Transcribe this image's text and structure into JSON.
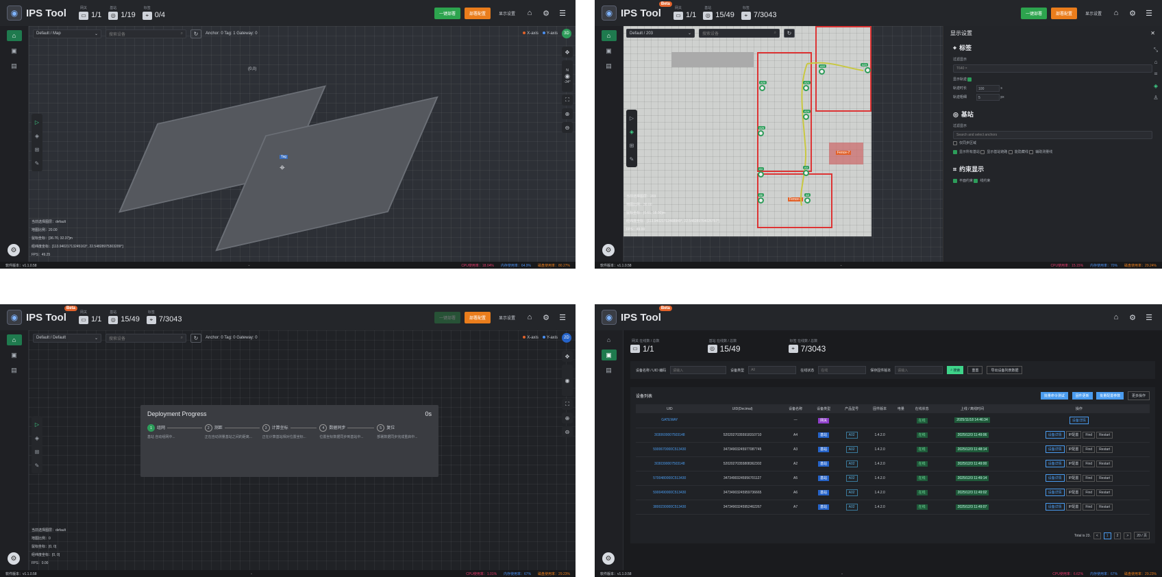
{
  "common": {
    "brand": "IPS Tool",
    "beta": "Beta",
    "btn_deploy": "一键部署",
    "btn_config": "部署配置",
    "btn_display": "显示设置",
    "version": "软件版本：v1.1.0.58",
    "axis_x": "X-axis",
    "axis_y": "Y-axis",
    "search_placeholder": "搜索设备",
    "stat_gateway": "网关",
    "stat_anchor": "基站",
    "stat_tag": "标签"
  },
  "p1": {
    "gateway": "1/1",
    "anchor": "1/19",
    "tag": "0/4",
    "map": "Default / Map",
    "counts": "Anchor: 0  Tag: 1  Gateway: 0",
    "avatar": "3D",
    "origin_label": "(0,0)",
    "tag_label": "Tag",
    "compass_top": "N",
    "compass_val": "30°",
    "compass_deg": "-34°",
    "info": [
      "当前选择图层：default",
      "地图比例：20.00",
      "鼠标坐标：[36.70, 32.37]m",
      "经纬度坐标：[113.94021713245163°, 22.54828975303209°]",
      "FPS：49.25"
    ],
    "cpu": "CPU使用率：18.04%",
    "ram": "内存使用率：64.9%",
    "disk": "磁盘使用率：80.27%"
  },
  "p2": {
    "gateway": "1/1",
    "anchor": "15/49",
    "tag": "7/3043",
    "map": "Default / 203",
    "settings_title": "显示设置",
    "sec_tag": "标签",
    "filter_label": "过滤显示",
    "filter_val": "T640 ×",
    "show_track": "显示轨迹",
    "track_time_label": "轨迹时长",
    "track_time_val": "100",
    "track_time_unit": "s",
    "track_width_label": "轨迹粗细",
    "track_width_val": "5",
    "track_width_unit": "px",
    "sec_anchor": "基站",
    "anchor_filter_placeholder": "Search and select anchors",
    "opt_sync": "仅同步区域",
    "opt_all": "显示所有基站",
    "opt_link": "显示基站链路",
    "opt_ghost": "能隐藏线",
    "opt_aux": "辅助测量线",
    "sec_constraint": "约束显示",
    "opt_plane": "平面约束",
    "opt_line": "线约束",
    "fence_label": "Fence-7",
    "fence_label2": "Fence-3",
    "info": [
      "当前选择图层：203",
      "地图比例：30.00",
      "鼠标坐标：[0.61, 18.90]m",
      "经纬度坐标：[113.94021712468849°, 22.548289764026757°]",
      "FPS：49.00"
    ],
    "cpu": "CPU使用率：15.15%",
    "ram": "内存使用率：70%",
    "disk": "磁盘使用率：29.24%",
    "anchor_labels": [
      "A20",
      "A21",
      "A22",
      "A23",
      "A24",
      "A25",
      "A4",
      "A3",
      "A6",
      "A5"
    ]
  },
  "p3": {
    "gateway": "1/1",
    "anchor": "15/49",
    "tag": "7/3043",
    "map": "Default / Default",
    "counts": "Anchor: 0  Tag: 0  Gateway: 0",
    "avatar": "2D",
    "modal_title": "Deployment Progress",
    "modal_time": "0s",
    "steps": [
      {
        "num": "1",
        "label": "组网",
        "desc": "基站 自动组网中..."
      },
      {
        "num": "2",
        "label": "测距",
        "desc": "正在自动测量基站之间的距离..."
      },
      {
        "num": "3",
        "label": "计算坐标",
        "desc": "正在计算基站相对位置坐标..."
      },
      {
        "num": "4",
        "label": "数据同步",
        "desc": "位置坐标数据同步到基站中..."
      },
      {
        "num": "5",
        "label": "复位",
        "desc": "部署数据同步完成重启中..."
      }
    ],
    "info": [
      "当前选择图层：default",
      "地图比例：0",
      "鼠标坐标：[0, 0]",
      "经纬度坐标：[0, 0]",
      "FPS：0.00"
    ],
    "cpu": "CPU使用率：1.01%",
    "ram": "内存使用率：67%",
    "disk": "磁盘使用率：29.23%"
  },
  "p4": {
    "gateway": "1/1",
    "anchor": "15/49",
    "tag": "7/3043",
    "lbl_gateway": "网关 在线数 / 总数",
    "lbl_anchor": "基站 在线数 / 总数",
    "lbl_tag": "标签 在线数 / 总数",
    "f_name": "设备名称 / UID 编码",
    "f_name_ph": "请输入",
    "f_type": "设备类型",
    "f_type_val": "All",
    "f_status": "在线状态",
    "f_status_val": "在线",
    "f_fw": "保存固件版本",
    "f_fw_ph": "请输入",
    "btn_search": "搜索",
    "btn_reset": "重置",
    "btn_export": "导出设备列表数据",
    "list_title": "设备列表",
    "btn_a": "批量命令测试",
    "btn_b": "固件更新",
    "btn_c": "批量配置参数",
    "btn_d": "更多操作",
    "cols": [
      "UID",
      "UID(Decimal)",
      "设备名称",
      "设备类型",
      "产品型号",
      "固件版本",
      "电量",
      "在线状态",
      "上线 / 离线时间",
      "操作"
    ],
    "rows": [
      {
        "uid": "GATEWAY",
        "dec": "",
        "name": "—",
        "type": "网关",
        "model": "",
        "fw": "",
        "batt": "",
        "status": "在线",
        "time": "2025/11/18 14:46:34",
        "ops": [
          "设备详情"
        ]
      },
      {
        "uid": "3030600007503148",
        "dec": "52020270355918310710",
        "name": "A4",
        "type": "基站",
        "model": "A02",
        "fw": "1.4.2.0",
        "batt": "",
        "status": "在线",
        "time": "2025/12/3 11:49:06",
        "ops": [
          "设备详情",
          "IP配置",
          "Find",
          "Restart"
        ]
      },
      {
        "uid": "5900670000C513430",
        "dec": "34734903245977087745",
        "name": "A3",
        "type": "基站",
        "model": "A02",
        "fw": "1.4.2.0",
        "batt": "",
        "status": "在线",
        "time": "2025/12/3 11:48:14",
        "ops": [
          "设备详情",
          "IP配置",
          "Find",
          "Restart"
        ]
      },
      {
        "uid": "3030390007503148",
        "dec": "52020270355808362302",
        "name": "A2",
        "type": "基站",
        "model": "A02",
        "fw": "1.4.2.0",
        "batt": "",
        "status": "在线",
        "time": "2025/12/3 11:49:00",
        "ops": [
          "设备详情",
          "IP配置",
          "Find",
          "Restart"
        ]
      },
      {
        "uid": "5700480000C513430",
        "dec": "34734903245956701127",
        "name": "A5",
        "type": "基站",
        "model": "A02",
        "fw": "1.4.2.0",
        "batt": "",
        "status": "在线",
        "time": "2025/12/3 11:49:14",
        "ops": [
          "设备详情",
          "IP配置",
          "Find",
          "Restart"
        ]
      },
      {
        "uid": "5900490000C513430",
        "dec": "34734903245959736665",
        "name": "A6",
        "type": "基站",
        "model": "A02",
        "fw": "1.4.2.0",
        "batt": "",
        "status": "在线",
        "time": "2025/12/3 11:49:02",
        "ops": [
          "设备详情",
          "IP配置",
          "Find",
          "Restart"
        ]
      },
      {
        "uid": "3800230000C513430",
        "dec": "34734903245952462267",
        "name": "A7",
        "type": "基站",
        "model": "A02",
        "fw": "1.4.2.0",
        "batt": "",
        "status": "在线",
        "time": "2025/12/3 11:49:07",
        "ops": [
          "设备详情",
          "IP配置",
          "Find",
          "Restart"
        ]
      }
    ],
    "total": "Total is 23.",
    "page_prev": "<",
    "page1": "1",
    "page2": "2",
    "page_next": ">",
    "page_size": "20 / 页",
    "cpu": "CPU使用率：6.62%",
    "ram": "内存使用率：67%",
    "disk": "磁盘使用率：29.23%"
  }
}
